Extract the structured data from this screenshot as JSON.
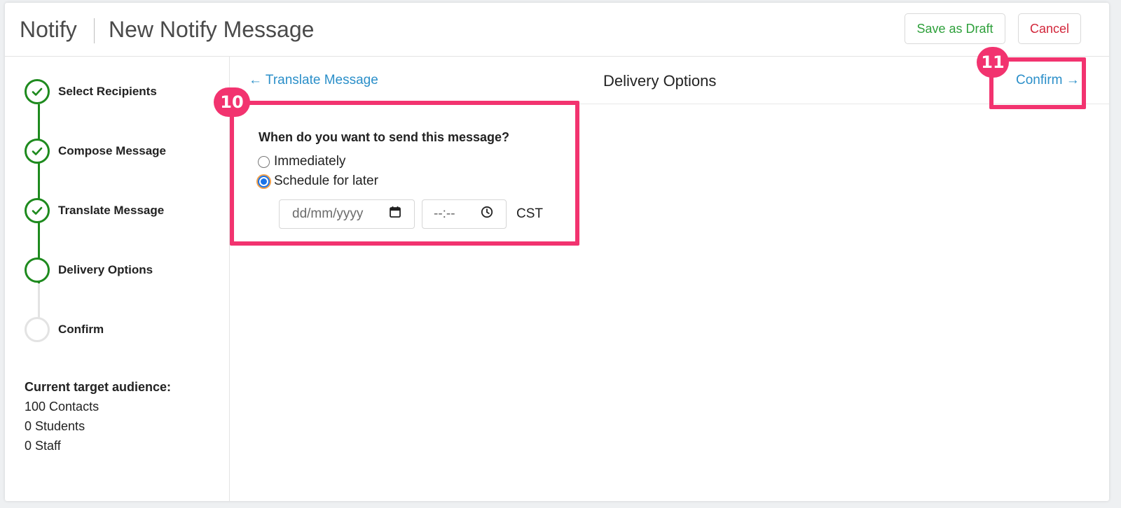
{
  "header": {
    "app_name": "Notify",
    "page_title": "New Notify Message",
    "save_draft_label": "Save as Draft",
    "cancel_label": "Cancel"
  },
  "sidebar": {
    "steps": [
      {
        "label": "Select Recipients",
        "status": "complete"
      },
      {
        "label": "Compose Message",
        "status": "complete"
      },
      {
        "label": "Translate Message",
        "status": "complete"
      },
      {
        "label": "Delivery Options",
        "status": "current"
      },
      {
        "label": "Confirm",
        "status": "pending"
      }
    ],
    "audience_title": "Current target audience:",
    "audience": [
      "100 Contacts",
      "0 Students",
      "0 Staff"
    ]
  },
  "main": {
    "back_label": "← Translate Message",
    "section_title": "Delivery Options",
    "next_label": "Confirm →",
    "question": "When do you want to send this message?",
    "options": [
      {
        "label": "Immediately",
        "selected": false
      },
      {
        "label": "Schedule for later",
        "selected": true
      }
    ],
    "date_placeholder": "dd/mm/yyyy",
    "time_placeholder": "--:--",
    "timezone": "CST"
  },
  "annotations": {
    "callout_10": "10",
    "callout_11": "11"
  },
  "colors": {
    "accent_link": "#2b8fc9",
    "step_complete": "#1e8a1e",
    "draft_green": "#2ea03b",
    "cancel_red": "#d2263b",
    "callout_pink": "#f2336f"
  }
}
